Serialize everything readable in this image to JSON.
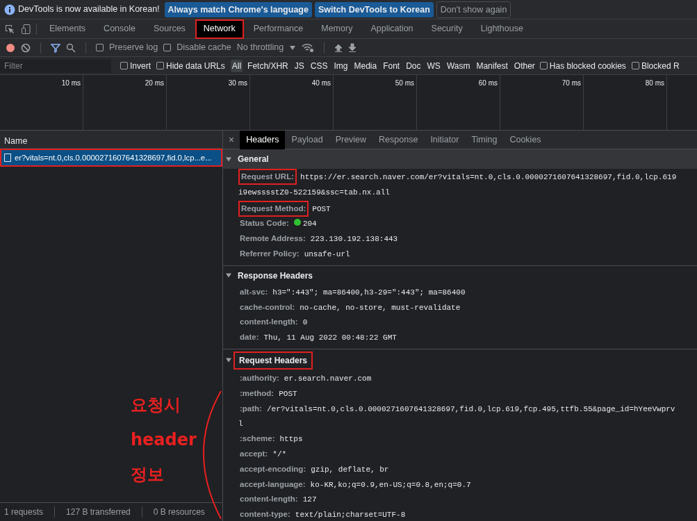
{
  "infobar": {
    "message": "DevTools is now available in Korean!",
    "buttons": [
      {
        "label": "Always match Chrome's language",
        "kind": "primary"
      },
      {
        "label": "Switch DevTools to Korean",
        "kind": "primary"
      },
      {
        "label": "Don't show again",
        "kind": "secondary"
      }
    ]
  },
  "panel_tabs": [
    {
      "label": "Elements",
      "selected": false,
      "highlighted": false
    },
    {
      "label": "Console",
      "selected": false,
      "highlighted": false
    },
    {
      "label": "Sources",
      "selected": false,
      "highlighted": false
    },
    {
      "label": "Network",
      "selected": true,
      "highlighted": true
    },
    {
      "label": "Performance",
      "selected": false,
      "highlighted": false
    },
    {
      "label": "Memory",
      "selected": false,
      "highlighted": false
    },
    {
      "label": "Application",
      "selected": false,
      "highlighted": false
    },
    {
      "label": "Security",
      "selected": false,
      "highlighted": false
    },
    {
      "label": "Lighthouse",
      "selected": false,
      "highlighted": false
    }
  ],
  "toolbar": {
    "recording": true,
    "preserve_log": {
      "label": "Preserve log",
      "checked": false
    },
    "disable_cache": {
      "label": "Disable cache",
      "checked": false
    },
    "throttling": "No throttling"
  },
  "filter": {
    "placeholder": "Filter",
    "options": [
      {
        "kind": "checkbox",
        "label": "Invert",
        "checked": false
      },
      {
        "kind": "checkbox",
        "label": "Hide data URLs",
        "checked": false
      },
      {
        "kind": "type",
        "label": "All",
        "selected": true
      },
      {
        "kind": "type",
        "label": "Fetch/XHR",
        "selected": false
      },
      {
        "kind": "type",
        "label": "JS",
        "selected": false
      },
      {
        "kind": "type",
        "label": "CSS",
        "selected": false
      },
      {
        "kind": "type",
        "label": "Img",
        "selected": false
      },
      {
        "kind": "type",
        "label": "Media",
        "selected": false
      },
      {
        "kind": "type",
        "label": "Font",
        "selected": false
      },
      {
        "kind": "type",
        "label": "Doc",
        "selected": false
      },
      {
        "kind": "type",
        "label": "WS",
        "selected": false
      },
      {
        "kind": "type",
        "label": "Wasm",
        "selected": false
      },
      {
        "kind": "type",
        "label": "Manifest",
        "selected": false
      },
      {
        "kind": "type",
        "label": "Other",
        "selected": false
      },
      {
        "kind": "checkbox",
        "label": "Has blocked cookies",
        "checked": false
      },
      {
        "kind": "checkbox",
        "label": "Blocked R",
        "checked": false
      }
    ]
  },
  "timeline": {
    "ticks": [
      "10 ms",
      "20 ms",
      "30 ms",
      "40 ms",
      "50 ms",
      "60 ms",
      "70 ms",
      "80 ms"
    ]
  },
  "requests": {
    "column": "Name",
    "rows": [
      {
        "name": "er?vitals=nt.0,cls.0.0000271607641328697,fid.0,lcp...e...",
        "selected": true,
        "highlighted": true
      }
    ]
  },
  "status_bar": [
    "1 requests",
    "127 B transferred",
    "0 B resources"
  ],
  "details": {
    "close": "×",
    "tabs": [
      {
        "label": "Headers",
        "selected": true
      },
      {
        "label": "Payload",
        "selected": false
      },
      {
        "label": "Preview",
        "selected": false
      },
      {
        "label": "Response",
        "selected": false
      },
      {
        "label": "Initiator",
        "selected": false
      },
      {
        "label": "Timing",
        "selected": false
      },
      {
        "label": "Cookies",
        "selected": false
      }
    ],
    "sections": [
      {
        "title": "General",
        "expanded": true,
        "highlighted": false,
        "rows": [
          {
            "name": "Request URL:",
            "value_lines": [
              "https://er.search.naver.com/er?vitals=nt.0,cls.0.0000271607641328697,fid.0,lcp.619",
              "i9ewsssstZ0-522159&ssc=tab.nx.all"
            ],
            "highlighted": true
          },
          {
            "name": "Request Method:",
            "value_lines": [
              "POST"
            ],
            "highlighted": true
          },
          {
            "name": "Status Code:",
            "value_lines": [
              "204"
            ],
            "highlighted": false,
            "kind": "status"
          },
          {
            "name": "Remote Address:",
            "value_lines": [
              "223.130.192.138:443"
            ],
            "highlighted": false
          },
          {
            "name": "Referrer Policy:",
            "value_lines": [
              "unsafe-url"
            ],
            "highlighted": false
          }
        ]
      },
      {
        "title": "Response Headers",
        "expanded": true,
        "highlighted": false,
        "rows": [
          {
            "name": "alt-svc:",
            "value_lines": [
              "h3=\":443\"; ma=86400,h3-29=\":443\"; ma=86400"
            ],
            "highlighted": false
          },
          {
            "name": "cache-control:",
            "value_lines": [
              "no-cache, no-store, must-revalidate"
            ],
            "highlighted": false
          },
          {
            "name": "content-length:",
            "value_lines": [
              "0"
            ],
            "highlighted": false
          },
          {
            "name": "date:",
            "value_lines": [
              "Thu, 11 Aug 2022 00:48:22 GMT"
            ],
            "highlighted": false
          }
        ]
      },
      {
        "title": "Request Headers",
        "expanded": true,
        "highlighted": true,
        "rows": [
          {
            "name": ":authority:",
            "value_lines": [
              "er.search.naver.com"
            ],
            "highlighted": false
          },
          {
            "name": ":method:",
            "value_lines": [
              "POST"
            ],
            "highlighted": false
          },
          {
            "name": ":path:",
            "value_lines": [
              "/er?vitals=nt.0,cls.0.0000271607641328697,fid.0,lcp.619,fcp.495,ttfb.55&page_id=hYeeVwprv",
              "l"
            ],
            "highlighted": false
          },
          {
            "name": ":scheme:",
            "value_lines": [
              "https"
            ],
            "highlighted": false
          },
          {
            "name": "accept:",
            "value_lines": [
              "*/*"
            ],
            "highlighted": false
          },
          {
            "name": "accept-encoding:",
            "value_lines": [
              "gzip, deflate, br"
            ],
            "highlighted": false
          },
          {
            "name": "accept-language:",
            "value_lines": [
              "ko-KR,ko;q=0.9,en-US;q=0.8,en;q=0.7"
            ],
            "highlighted": false
          },
          {
            "name": "content-length:",
            "value_lines": [
              "127"
            ],
            "highlighted": false
          },
          {
            "name": "content-type:",
            "value_lines": [
              "text/plain;charset=UTF-8"
            ],
            "highlighted": false
          }
        ]
      }
    ]
  },
  "annotation": {
    "lines": [
      "요청시",
      "header",
      "정보"
    ]
  }
}
